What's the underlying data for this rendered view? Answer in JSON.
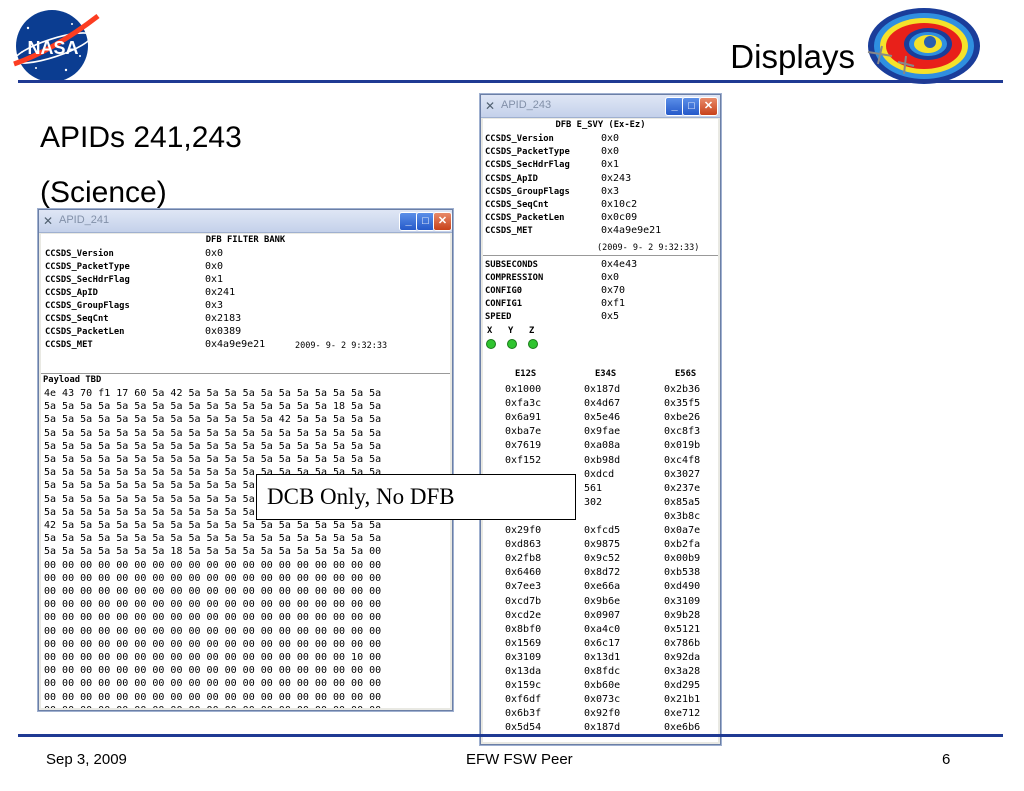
{
  "slide": {
    "title": "Displays",
    "subtitle_lines": [
      "APIDs 241,243",
      "(Science)"
    ],
    "callout": "DCB Only, No DFB",
    "footer": {
      "date": "Sep 3, 2009",
      "center": "EFW FSW Peer",
      "page": "6"
    },
    "colors": {
      "rule": "#1f3a93"
    },
    "logo_text": "NASA"
  },
  "window_241": {
    "title": "APID_241",
    "heading": "DFB FILTER BANK",
    "fields": [
      {
        "label": "CCSDS_Version",
        "value": "0x0"
      },
      {
        "label": "CCSDS_PacketType",
        "value": "0x0"
      },
      {
        "label": "CCSDS_SecHdrFlag",
        "value": "0x1"
      },
      {
        "label": "CCSDS_ApID",
        "value": "0x241"
      },
      {
        "label": "CCSDS_GroupFlags",
        "value": "0x3"
      },
      {
        "label": "CCSDS_SeqCnt",
        "value": "0x2183"
      },
      {
        "label": "CCSDS_PacketLen",
        "value": "0x0389"
      },
      {
        "label": "CCSDS_MET",
        "value": "0x4a9e9e21"
      }
    ],
    "met_date": "2009- 9- 2   9:32:33",
    "payload_label": "Payload TBD",
    "payload_rows": [
      "4e 43 70 f1 17 60 5a 42 5a 5a 5a 5a 5a 5a 5a 5a 5a 5a 5a",
      "5a 5a 5a 5a 5a 5a 5a 5a 5a 5a 5a 5a 5a 5a 5a 5a 18 5a 5a",
      "5a 5a 5a 5a 5a 5a 5a 5a 5a 5a 5a 5a 5a 42 5a 5a 5a 5a 5a",
      "5a 5a 5a 5a 5a 5a 5a 5a 5a 5a 5a 5a 5a 5a 5a 5a 5a 5a 5a",
      "5a 5a 5a 5a 5a 5a 5a 5a 5a 5a 5a 5a 5a 5a 5a 5a 5a 5a 5a",
      "5a 5a 5a 5a 5a 5a 5a 5a 5a 5a 5a 5a 5a 5a 5a 5a 5a 5a 5a",
      "5a 5a 5a 5a 5a 5a 5a 5a 5a 5a 5a 5a 5a 5a 5a 5a 5a 5a 5a",
      "5a 5a 5a 5a 5a 5a 5a 5a 5a 5a 5a 5a 5a 5a 5a 5a 5a 5a 5a",
      "5a 5a 5a 5a 5a 5a 5a 5a 5a 5a 5a 5a 5a 5a 5a 5a 5a 5a 5a",
      "5a 5a 5a 5a 5a 5a 5a 5a 5a 5a 5a 5a 5a 5a 5a 5a 5a 5a 5a",
      "42 5a 5a 5a 5a 5a 5a 5a 5a 5a 5a 5a 5a 5a 5a 5a 5a 5a 5a",
      "5a 5a 5a 5a 5a 5a 5a 5a 5a 5a 5a 5a 5a 5a 5a 5a 5a 5a 5a",
      "5a 5a 5a 5a 5a 5a 5a 18 5a 5a 5a 5a 5a 5a 5a 5a 5a 5a 00",
      "00 00 00 00 00 00 00 00 00 00 00 00 00 00 00 00 00 00 00",
      "00 00 00 00 00 00 00 00 00 00 00 00 00 00 00 00 00 00 00",
      "00 00 00 00 00 00 00 00 00 00 00 00 00 00 00 00 00 00 00",
      "00 00 00 00 00 00 00 00 00 00 00 00 00 00 00 00 00 00 00",
      "00 00 00 00 00 00 00 00 00 00 00 00 00 00 00 00 00 00 00",
      "00 00 00 00 00 00 00 00 00 00 00 00 00 00 00 00 00 00 00",
      "00 00 00 00 00 00 00 00 00 00 00 00 00 00 00 00 00 00 00",
      "00 00 00 00 00 00 00 00 00 00 00 00 00 00 00 00 00 10 00",
      "00 00 00 00 00 00 00 00 00 00 00 00 00 00 00 00 00 00 00",
      "00 00 00 00 00 00 00 00 00 00 00 00 00 00 00 00 00 00 00",
      "00 00 00 00 00 00 00 00 00 00 00 00 00 00 00 00 00 00 00",
      "00 00 00 00 00 00 00 00 00 00 00 00 00 00 00 00 00 00 00"
    ]
  },
  "window_243": {
    "title": "APID_243",
    "heading": "DFB E_SVY (Ex-Ez)",
    "fields": [
      {
        "label": "CCSDS_Version",
        "value": "0x0"
      },
      {
        "label": "CCSDS_PacketType",
        "value": "0x0"
      },
      {
        "label": "CCSDS_SecHdrFlag",
        "value": "0x1"
      },
      {
        "label": "CCSDS_ApID",
        "value": "0x243"
      },
      {
        "label": "CCSDS_GroupFlags",
        "value": "0x3"
      },
      {
        "label": "CCSDS_SeqCnt",
        "value": "0x10c2"
      },
      {
        "label": "CCSDS_PacketLen",
        "value": "0x0c09"
      },
      {
        "label": "CCSDS_MET",
        "value": "0x4a9e9e21"
      }
    ],
    "met_date": "(2009- 9- 2   9:32:33)",
    "config_fields": [
      {
        "label": "SUBSECONDS",
        "value": "0x4e43"
      },
      {
        "label": "COMPRESSION",
        "value": "0x0"
      },
      {
        "label": "CONFIG0",
        "value": "0x70"
      },
      {
        "label": "CONFIG1",
        "value": "0xf1"
      },
      {
        "label": "SPEED",
        "value": "0x5"
      }
    ],
    "axes": [
      "X",
      "Y",
      "Z"
    ],
    "led_color": "#2fc42f",
    "columns": [
      "E12S",
      "E34S",
      "E56S"
    ],
    "rows": [
      [
        "0x1000",
        "0x187d",
        "0x2b36"
      ],
      [
        "0xfa3c",
        "0x4d67",
        "0x35f5"
      ],
      [
        "0x6a91",
        "0x5e46",
        "0xbe26"
      ],
      [
        "0xba7e",
        "0x9fae",
        "0xc8f3"
      ],
      [
        "0x7619",
        "0xa08a",
        "0x019b"
      ],
      [
        "0xf152",
        "0xb98d",
        "0xc4f8"
      ],
      [
        "",
        "0xdcd",
        "0x3027"
      ],
      [
        "",
        "561",
        "0x237e"
      ],
      [
        "",
        "302",
        "0x85a5"
      ],
      [
        "",
        "",
        "0x3b8c"
      ],
      [
        "0x29f0",
        "0xfcd5",
        "0x0a7e"
      ],
      [
        "0xd863",
        "0x9875",
        "0xb2fa"
      ],
      [
        "0x2fb8",
        "0x9c52",
        "0x00b9"
      ],
      [
        "0x6460",
        "0x8d72",
        "0xb538"
      ],
      [
        "0x7ee3",
        "0xe66a",
        "0xd490"
      ],
      [
        "0xcd7b",
        "0x9b6e",
        "0x3109"
      ],
      [
        "0xcd2e",
        "0x0907",
        "0x9b28"
      ],
      [
        "0x8bf0",
        "0xa4c0",
        "0x5121"
      ],
      [
        "0x1569",
        "0x6c17",
        "0x786b"
      ],
      [
        "0x3109",
        "0x13d1",
        "0x92da"
      ],
      [
        "0x13da",
        "0x8fdc",
        "0x3a28"
      ],
      [
        "0x159c",
        "0xb60e",
        "0xd295"
      ],
      [
        "0xf6df",
        "0x073c",
        "0x21b1"
      ],
      [
        "0x6b3f",
        "0x92f0",
        "0xe712"
      ],
      [
        "0x5d54",
        "0x187d",
        "0xe6b6"
      ]
    ]
  }
}
